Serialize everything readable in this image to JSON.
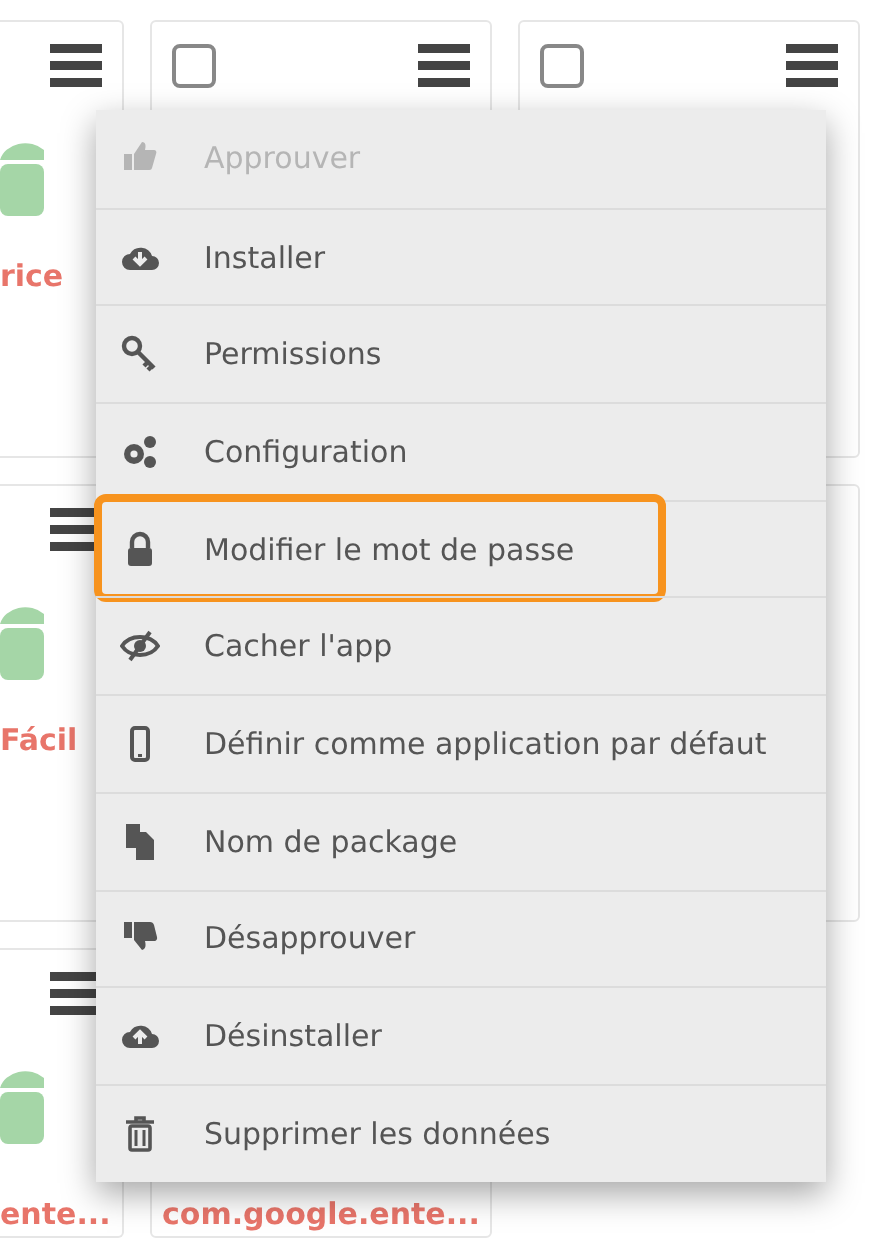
{
  "cards": [
    {
      "name": "rice",
      "color": "#e8756a"
    },
    {
      "checked": false
    },
    {
      "checked": false
    },
    {
      "name": "Fácil",
      "color": "#e8756a"
    },
    {
      "name": "ente...",
      "color": "#e8756a"
    },
    {
      "name": "com.google.ente...",
      "color": "#e8756a"
    }
  ],
  "menu": [
    {
      "label": "Approuver",
      "disabled": true,
      "highlighted": false
    },
    {
      "label": "Installer",
      "disabled": false,
      "highlighted": false
    },
    {
      "label": "Permissions",
      "disabled": false,
      "highlighted": false
    },
    {
      "label": "Configuration",
      "disabled": false,
      "highlighted": false
    },
    {
      "label": "Modifier le mot de passe",
      "disabled": false,
      "highlighted": true
    },
    {
      "label": "Cacher l'app",
      "disabled": false,
      "highlighted": false
    },
    {
      "label": "Définir comme application par défaut",
      "disabled": false,
      "highlighted": false
    },
    {
      "label": "Nom de package",
      "disabled": false,
      "highlighted": false
    },
    {
      "label": "Désapprouver",
      "disabled": false,
      "highlighted": false
    },
    {
      "label": "Désinstaller",
      "disabled": false,
      "highlighted": false
    },
    {
      "label": "Supprimer les données",
      "disabled": false,
      "highlighted": false
    }
  ]
}
